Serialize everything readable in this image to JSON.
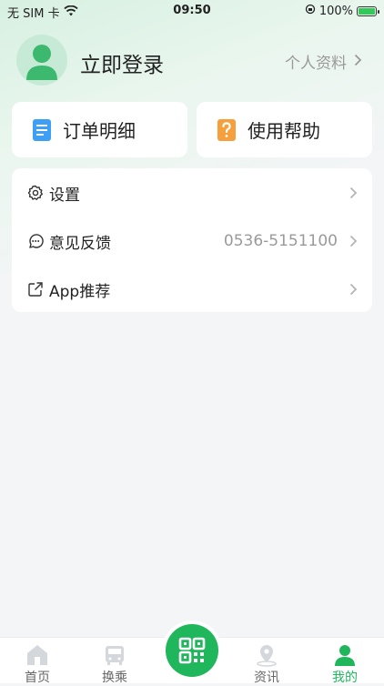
{
  "status_bar": {
    "carrier": "无 SIM 卡",
    "time": "09:50",
    "battery": "100%"
  },
  "profile": {
    "login_label": "立即登录",
    "profile_link": "个人资料"
  },
  "quick_cards": [
    {
      "label": "订单明细",
      "icon": "document-icon"
    },
    {
      "label": "使用帮助",
      "icon": "help-icon"
    }
  ],
  "menu": [
    {
      "label": "设置",
      "value": "",
      "icon": "gear-icon"
    },
    {
      "label": "意见反馈",
      "value": "0536-5151100",
      "icon": "feedback-icon"
    },
    {
      "label": "App推荐",
      "value": "",
      "icon": "share-icon"
    }
  ],
  "tabbar": [
    {
      "label": "首页",
      "icon": "home-icon",
      "active": false
    },
    {
      "label": "换乘",
      "icon": "bus-icon",
      "active": false
    },
    {
      "label": "资讯",
      "icon": "news-icon",
      "active": false
    },
    {
      "label": "我的",
      "icon": "user-icon",
      "active": true
    }
  ],
  "colors": {
    "accent": "#20b65c",
    "inactive_icon": "#d4d7dc"
  }
}
